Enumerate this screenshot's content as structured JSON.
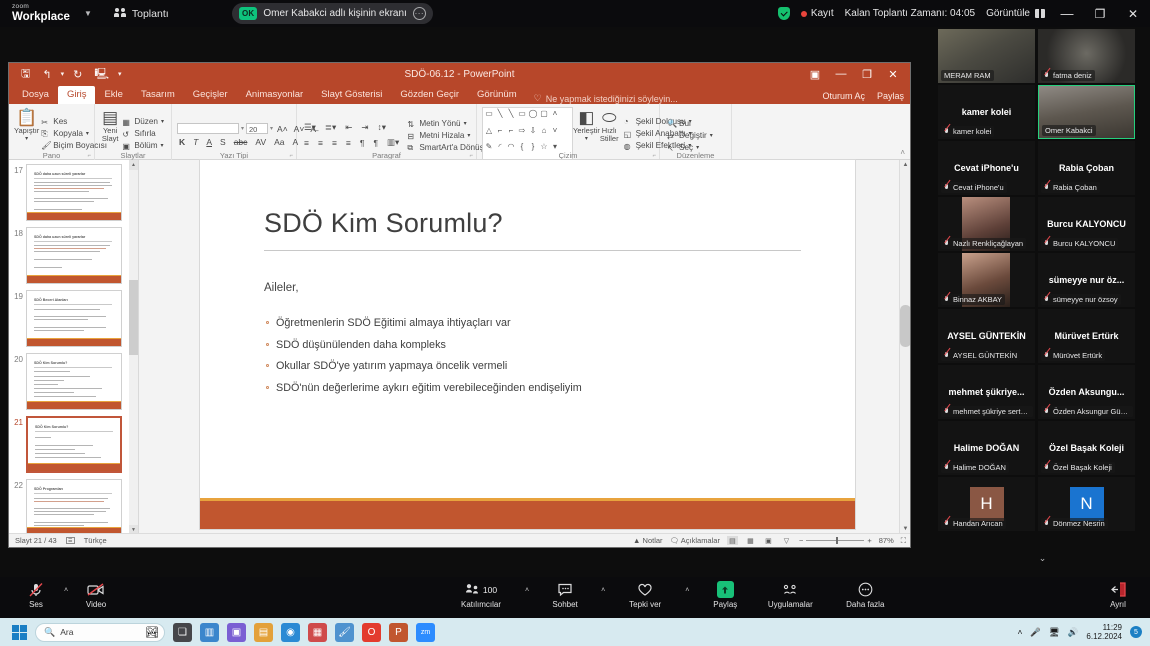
{
  "zoom_topbar": {
    "logo_small": "zoom",
    "logo_big": "Workplace",
    "meeting_label": "Toplantı",
    "share_badge": "OK",
    "share_text": "Omer Kabakci adlı kişinin ekranı",
    "recording_label": "Kayıt",
    "timer_text": "Kalan Toplantı Zamanı: 04:05",
    "view_label": "Görüntüle",
    "minimize": "—",
    "maximize": "❐",
    "close": "✕"
  },
  "powerpoint": {
    "title": "SDÖ-06.12 - PowerPoint",
    "qat": {
      "save": "🖫",
      "undo": "↰",
      "redo": "↻",
      "present": "🖳",
      "more": "▾"
    },
    "window_controls": {
      "ribbon_display": "▣",
      "minimize": "—",
      "restore": "❐",
      "close": "✕"
    },
    "tabs": [
      "Dosya",
      "Giriş",
      "Ekle",
      "Tasarım",
      "Geçişler",
      "Animasyonlar",
      "Slayt Gösterisi",
      "Gözden Geçir",
      "Görünüm"
    ],
    "active_tab": "Giriş",
    "tell_me": "Ne yapmak istediğinizi söyleyin...",
    "account": {
      "signin": "Oturum Aç",
      "share": "Paylaş"
    },
    "ribbon_groups": [
      {
        "name": "Pano",
        "big_button": "Yapıştır",
        "items": [
          "Kes",
          "Kopyala",
          "Biçim Boyacısı"
        ]
      },
      {
        "name": "Slaytlar",
        "big_button": "Yeni Slayt",
        "items": [
          "Düzen",
          "Sıfırla",
          "Bölüm"
        ]
      },
      {
        "name": "Yazı Tipi",
        "font_name": "",
        "font_size": "20",
        "items": [
          "K",
          "T",
          "A",
          "S",
          "abc",
          "AV",
          "Aa",
          "A"
        ]
      },
      {
        "name": "Paragraf",
        "items": [
          "Metin Yönü",
          "Metni Hizala",
          "SmartArt'a Dönüştür"
        ]
      },
      {
        "name": "Çizim",
        "items": [
          "Yerleştir",
          "Hızlı Stiller",
          "Şekil Dolgusu",
          "Şekil Anahattı",
          "Şekil Efektleri"
        ]
      },
      {
        "name": "Düzenleme",
        "items": [
          "Bul",
          "Değiştir",
          "Seç"
        ]
      }
    ],
    "thumbnails": [
      {
        "number": "17",
        "selected": false
      },
      {
        "number": "18",
        "selected": false
      },
      {
        "number": "19",
        "selected": false
      },
      {
        "number": "20",
        "selected": false
      },
      {
        "number": "21",
        "selected": true
      },
      {
        "number": "22",
        "selected": false
      }
    ],
    "slide": {
      "title": "SDÖ Kim Sorumlu?",
      "intro": "Aileler,",
      "bullets": [
        "Öğretmenlerin SDÖ Eğitimi almaya ihtiyaçları var",
        "SDÖ düşünülenden daha kompleks",
        "Okullar SDÖ'ye yatırım yapmaya öncelik vermeli",
        "SDÖ'nün değerlerime aykırı eğitim verebileceğinden endişeliyim"
      ]
    },
    "statusbar": {
      "slide_counter": "Slayt 21 / 43",
      "language": "Türkçe",
      "notes": "Notlar",
      "comments": "Açıklamalar",
      "zoom_level": "87%"
    }
  },
  "gallery": {
    "participants": [
      {
        "name": "MERAM RAM",
        "label": "MERAM RAM",
        "type": "video",
        "muted": false,
        "speaking": false,
        "label_style": "corner"
      },
      {
        "name": "fatma deniz",
        "label": "fatma deniz",
        "type": "video",
        "muted": true,
        "speaking": false,
        "label_style": "corner"
      },
      {
        "name": "kamer kolei",
        "label": "kamer kolei",
        "type": "name",
        "muted": true,
        "speaking": false,
        "label_style": "center"
      },
      {
        "name": "Omer Kabakci",
        "label": "Omer Kabakci",
        "type": "video",
        "muted": false,
        "speaking": true,
        "label_style": "corner"
      },
      {
        "name": "Cevat iPhone'u",
        "label": "Cevat iPhone'u",
        "type": "name",
        "muted": true,
        "speaking": false,
        "label_style": "center"
      },
      {
        "name": "Rabia Çoban",
        "label": "Rabia Çoban",
        "type": "name",
        "muted": true,
        "speaking": false,
        "label_style": "center"
      },
      {
        "name": "Nazlı Renkliçağlayan",
        "label": "Nazlı Renkliçağlayan",
        "type": "video",
        "muted": true,
        "speaking": false,
        "label_style": "corner"
      },
      {
        "name": "Burcu KALYONCU",
        "label": "Burcu KALYONCU",
        "type": "name",
        "muted": true,
        "speaking": false,
        "label_style": "center"
      },
      {
        "name": "Binnaz AKBAY",
        "label": "Binnaz AKBAY",
        "type": "video",
        "muted": true,
        "speaking": false,
        "label_style": "corner"
      },
      {
        "name": "sümeyye nur öz...",
        "label": "sümeyye nur özsoy",
        "type": "name",
        "muted": true,
        "speaking": false,
        "label_style": "center"
      },
      {
        "name": "AYSEL GÜNTEKİN",
        "label": "AYSEL GÜNTEKİN",
        "type": "name",
        "muted": true,
        "speaking": false,
        "label_style": "center"
      },
      {
        "name": "Mürüvet Ertürk",
        "label": "Mürüvet Ertürk",
        "type": "name",
        "muted": true,
        "speaking": false,
        "label_style": "center"
      },
      {
        "name": "mehmet şükriye...",
        "label": "mehmet şükriye sert i...",
        "type": "name",
        "muted": true,
        "speaking": false,
        "label_style": "center"
      },
      {
        "name": "Özden  Aksungu...",
        "label": "Özden Aksungur Gün...",
        "type": "name",
        "muted": true,
        "speaking": false,
        "label_style": "center"
      },
      {
        "name": "Halime DOĞAN",
        "label": "Halime DOĞAN",
        "type": "name",
        "muted": true,
        "speaking": false,
        "label_style": "center"
      },
      {
        "name": "Özel Başak Koleji",
        "label": "Özel Başak Koleji",
        "type": "name",
        "muted": true,
        "speaking": false,
        "label_style": "center"
      },
      {
        "name": "Handan Arıcan",
        "label": "Handan Arıcan",
        "type": "initial",
        "initial": "H",
        "color": "#8a5744",
        "muted": true,
        "speaking": false,
        "label_style": "corner"
      },
      {
        "name": "Dönmez Nesrin",
        "label": "Dönmez Nesrin",
        "type": "initial",
        "initial": "N",
        "color": "#1a74d0",
        "muted": true,
        "speaking": false,
        "label_style": "corner"
      }
    ],
    "more_indicator": "⌄"
  },
  "zoom_toolbar": {
    "audio_label": "Ses",
    "video_label": "Video",
    "participants_label": "Katılımcılar",
    "participants_count": "100",
    "chat_label": "Sohbet",
    "reactions_label": "Tepki ver",
    "share_label": "Paylaş",
    "apps_label": "Uygulamalar",
    "more_label": "Daha fazla",
    "leave_label": "Ayrıl"
  },
  "taskbar": {
    "search_placeholder": "Ara",
    "time": "11:29",
    "date": "6.12.2024",
    "tray_badge": "5",
    "apps": [
      {
        "name": "task-view",
        "glyph": "❏",
        "color": "#3a3a3a"
      },
      {
        "name": "widgets",
        "glyph": "▥",
        "color": "#2e7fd0"
      },
      {
        "name": "chat",
        "glyph": "💬",
        "color": "#8764d8"
      },
      {
        "name": "file-explorer",
        "glyph": "🗀",
        "color": "#f0b429"
      },
      {
        "name": "edge",
        "glyph": "◉",
        "color": "#1b84d8"
      },
      {
        "name": "store",
        "glyph": "▦",
        "color": "#d04a4a"
      },
      {
        "name": "paint",
        "glyph": "🖌",
        "color": "#4a8ad0"
      },
      {
        "name": "opera",
        "glyph": "O",
        "color": "#e33b2e"
      },
      {
        "name": "powerpoint",
        "glyph": "P",
        "color": "#c1562f"
      },
      {
        "name": "zoom",
        "glyph": "zm",
        "color": "#2d8cff"
      }
    ]
  }
}
